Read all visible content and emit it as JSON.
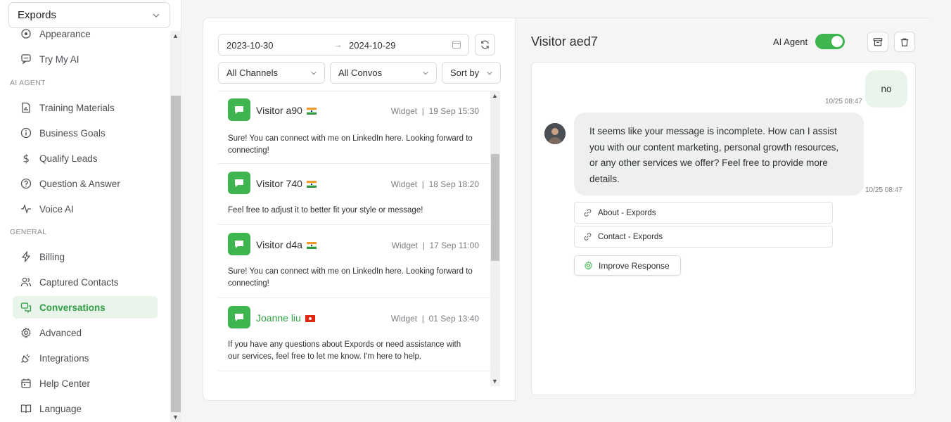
{
  "workspace": {
    "name": "Expords"
  },
  "sidebar": {
    "partial_item": "Appearance",
    "items_top": [
      {
        "label": "Try My AI",
        "icon": "chat-icon"
      }
    ],
    "section_ai": "AI AGENT",
    "items_ai": [
      {
        "label": "Training Materials",
        "icon": "document-chart-icon"
      },
      {
        "label": "Business Goals",
        "icon": "info-icon"
      },
      {
        "label": "Qualify Leads",
        "icon": "dollar-icon"
      },
      {
        "label": "Question & Answer",
        "icon": "question-icon"
      },
      {
        "label": "Voice AI",
        "icon": "waveform-icon"
      }
    ],
    "section_general": "GENERAL",
    "items_general": [
      {
        "label": "Billing",
        "icon": "lightning-icon"
      },
      {
        "label": "Captured Contacts",
        "icon": "users-icon"
      },
      {
        "label": "Conversations",
        "icon": "conversations-icon",
        "active": true
      },
      {
        "label": "Advanced",
        "icon": "gear-icon"
      },
      {
        "label": "Integrations",
        "icon": "plug-icon"
      },
      {
        "label": "Help Center",
        "icon": "calendar-icon"
      },
      {
        "label": "Language",
        "icon": "book-icon"
      }
    ]
  },
  "filters": {
    "date_from": "2023-10-30",
    "date_arrow": "→",
    "date_to": "2024-10-29",
    "channels": "All Channels",
    "convos": "All Convos",
    "sort": "Sort by"
  },
  "conversations": [
    {
      "name": "Visitor a90",
      "flag": "in",
      "channel": "Widget",
      "date": "19 Sep 15:30",
      "message": "Sure! You can connect with me on LinkedIn here. Looking forward to connecting!",
      "highlight": false
    },
    {
      "name": "Visitor 740",
      "flag": "in",
      "channel": "Widget",
      "date": "18 Sep 18:20",
      "message": "Feel free to adjust it to better fit your style or message!",
      "highlight": false
    },
    {
      "name": "Visitor d4a",
      "flag": "in",
      "channel": "Widget",
      "date": "17 Sep 11:00",
      "message": "Sure! You can connect with me on LinkedIn here. Looking forward to connecting!",
      "highlight": false
    },
    {
      "name": "Joanne liu",
      "flag": "hk",
      "channel": "Widget",
      "date": "01 Sep 13:40",
      "message": "If you have any questions about Expords or need assistance with our services, feel free to let me know. I'm here to help.",
      "highlight": true
    }
  ],
  "chat": {
    "title": "Visitor aed7",
    "ai_agent_label": "AI Agent",
    "ai_agent_on": true,
    "user_message": "no",
    "user_time": "10/25 08:47",
    "bot_message": "It seems like your message is incomplete. How can I assist you with our content marketing, personal growth resources, or any other services we offer? Feel free to provide more details.",
    "bot_time": "10/25 08:47",
    "links": [
      "About - Expords",
      "Contact - Expords"
    ],
    "improve_label": "Improve Response"
  },
  "colors": {
    "accent": "#3fb54f",
    "accent_dark": "#2f9e44",
    "accent_light": "#e9f5ea"
  }
}
